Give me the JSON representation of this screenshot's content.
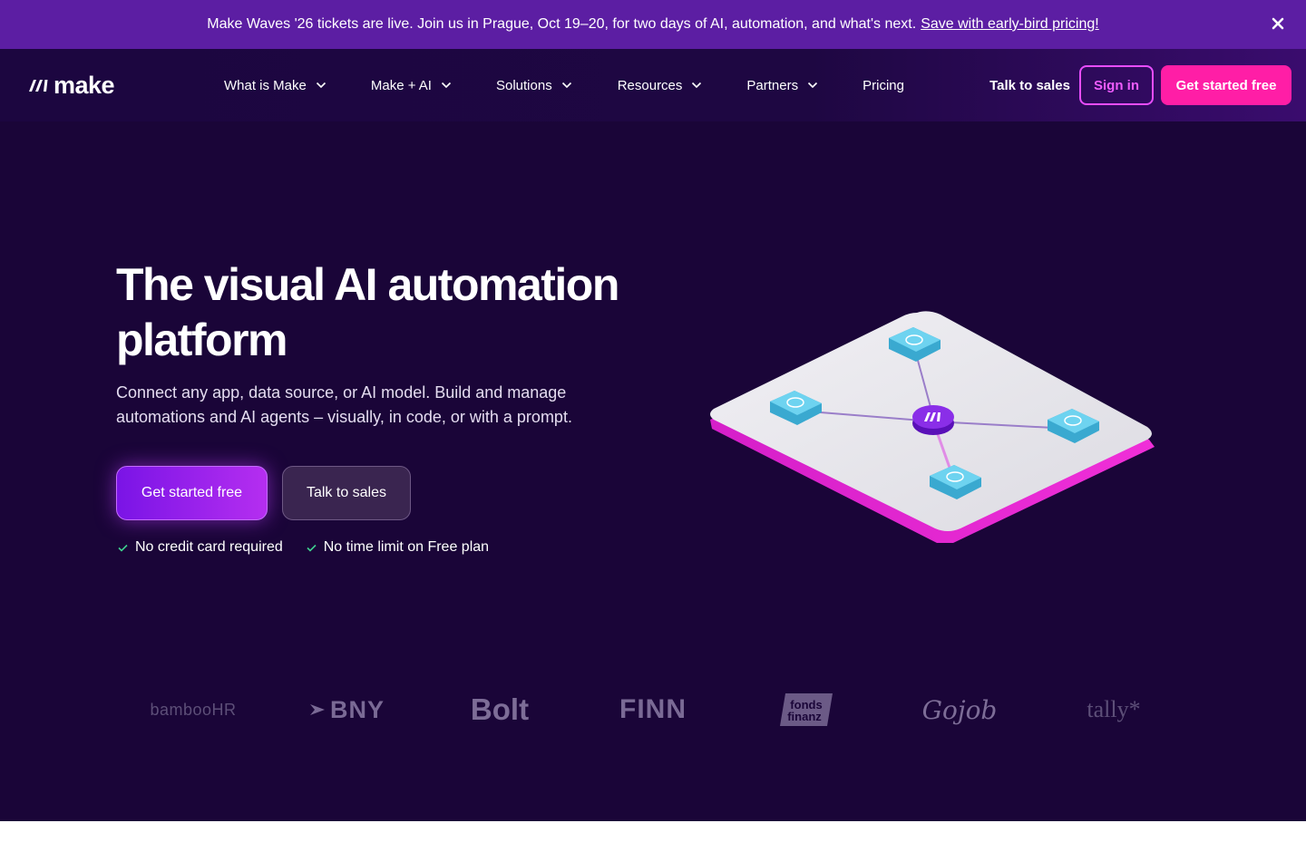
{
  "banner": {
    "message": "Make Waves '26 tickets are live. Join us in Prague, Oct 19–20, for two days of AI, automation, and what's next.",
    "link": "Save with early-bird pricing!",
    "close_icon": "close-icon"
  },
  "nav": {
    "logo_text": "make",
    "logo_icon": "make-logo-icon",
    "menu": [
      {
        "label": "What is Make",
        "icon": "chevron-down-icon"
      },
      {
        "label": "Make + AI",
        "icon": "chevron-down-icon"
      },
      {
        "label": "Solutions",
        "icon": "chevron-down-icon"
      },
      {
        "label": "Resources",
        "icon": "chevron-down-icon"
      },
      {
        "label": "Partners",
        "icon": "chevron-down-icon"
      },
      {
        "label": "Pricing"
      }
    ],
    "talk_to_sales": "Talk to sales",
    "sign_in": "Sign in",
    "get_started": "Get started free"
  },
  "hero": {
    "title_line1": "The visual AI automation",
    "title_line2": "platform",
    "subtitle_line1": "Connect any app, data source, or AI model. Build and manage",
    "subtitle_line2": "automations and AI agents – visually, in code, or with a prompt.",
    "cta_primary": "Get started free",
    "cta_secondary": "Talk to sales",
    "checks": [
      {
        "label": "No credit card required",
        "icon": "check-icon"
      },
      {
        "label": "No time limit on Free plan",
        "icon": "check-icon"
      }
    ]
  },
  "logos": {
    "bamboo": "bambooHR",
    "bny": "BNY",
    "bolt": "Bolt",
    "finn": "FINN",
    "fonds_line1": "fonds",
    "fonds_line2": "finanz",
    "gojob": "Gojob",
    "tally": "tally*"
  },
  "colors": {
    "background": "#1a0538",
    "banner": "#5c1ea3",
    "accent_pink": "#ff1ea6",
    "accent_purple": "#7a14e6",
    "signin_border": "#e84dff"
  }
}
